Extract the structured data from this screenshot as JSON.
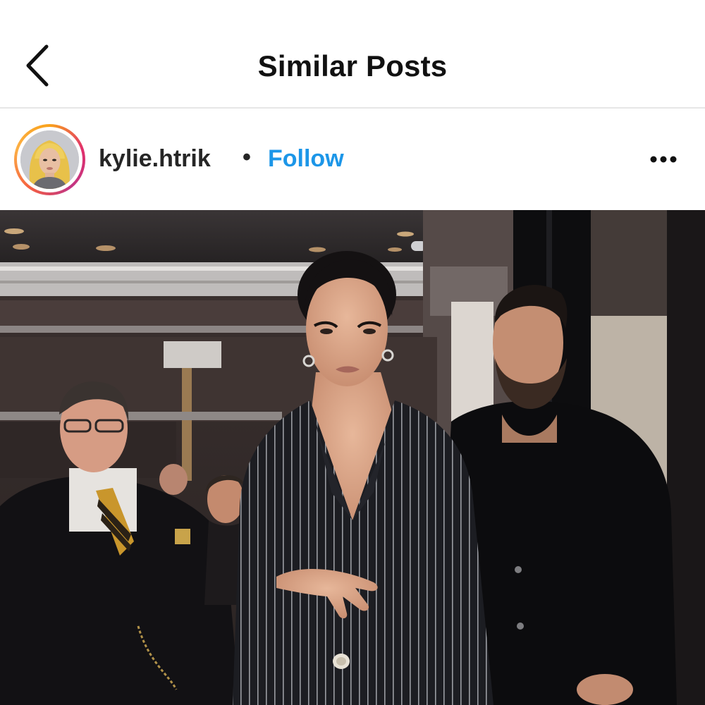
{
  "nav": {
    "title": "Similar Posts",
    "back_icon": "chevron-left-icon"
  },
  "post": {
    "username": "kylie.htrik",
    "separator": "•",
    "follow_label": "Follow",
    "more_icon": "more-horizontal-icon",
    "avatar_icon": "profile-avatar"
  },
  "colors": {
    "follow_blue": "#1c96e8",
    "title_text": "#111111",
    "divider": "#e6e6e6"
  }
}
